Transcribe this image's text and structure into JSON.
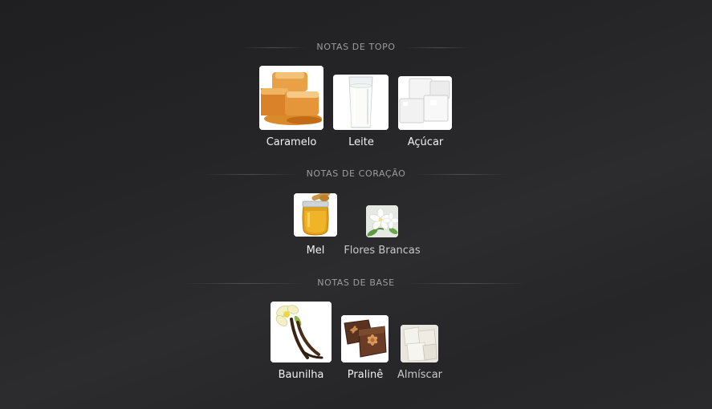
{
  "sections": [
    {
      "title": "NOTAS DE TOPO",
      "notes": [
        {
          "name": "Caramelo",
          "icon": "caramel-icon"
        },
        {
          "name": "Leite",
          "icon": "milk-glass-icon"
        },
        {
          "name": "Açúcar",
          "icon": "sugar-cubes-icon"
        }
      ]
    },
    {
      "title": "NOTAS DE CORAÇÃO",
      "notes": [
        {
          "name": "Mel",
          "icon": "honey-jar-icon"
        },
        {
          "name": "Flores Brancas",
          "icon": "white-flowers-icon"
        }
      ]
    },
    {
      "title": "NOTAS DE BASE",
      "notes": [
        {
          "name": "Baunilha",
          "icon": "vanilla-icon"
        },
        {
          "name": "Pralinê",
          "icon": "praline-chocolate-icon"
        },
        {
          "name": "Almíscar",
          "icon": "musk-icon"
        }
      ]
    }
  ]
}
